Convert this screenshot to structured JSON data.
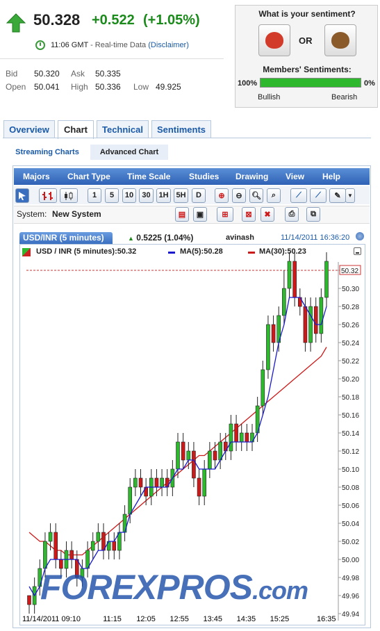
{
  "quote": {
    "price": "50.328",
    "change": "+0.522",
    "change_pct": "(+1.05%)",
    "time": "11:06 GMT",
    "time_note": "- Real-time Data",
    "disclaimer": "(Disclaimer)",
    "bid_label": "Bid",
    "bid": "50.320",
    "ask_label": "Ask",
    "ask": "50.335",
    "open_label": "Open",
    "open": "50.041",
    "high_label": "High",
    "high": "50.336",
    "low_label": "Low",
    "low": "49.925",
    "arrow_icon": "up-arrow-icon",
    "accent_color": "#1a8a1a"
  },
  "sentiment": {
    "title": "What is your sentiment?",
    "or": "OR",
    "members_label": "Members' Sentiments:",
    "bullish_pct": "100%",
    "bearish_pct": "0%",
    "bullish_label": "Bullish",
    "bearish_label": "Bearish",
    "bullish_fraction": 1.0
  },
  "tabs": [
    "Overview",
    "Chart",
    "Technical",
    "Sentiments"
  ],
  "active_tab": "Chart",
  "subtabs": [
    "Streaming Charts",
    "Advanced Chart"
  ],
  "active_subtab": "Advanced Chart",
  "menu": [
    "Majors",
    "Chart Type",
    "Time Scale",
    "Studies",
    "Drawing",
    "View",
    "Help"
  ],
  "toolbar": {
    "timeframes": [
      "1",
      "5",
      "10",
      "30",
      "1H",
      "5H",
      "D"
    ]
  },
  "system": {
    "label": "System:",
    "name": "New System"
  },
  "chart_header": {
    "instrument": "USD/INR (5 minutes)",
    "change": "0.5225 (1.04%)",
    "user": "avinash",
    "timestamp": "11/14/2011 16:36:20"
  },
  "legend": {
    "main": "USD / INR (5 minutes):50.32",
    "ma5": "MA(5):50.28",
    "ma30": "MA(30):50.23",
    "ma5_color": "#1a1acc",
    "ma30_color": "#cc1a1a"
  },
  "watermark": {
    "main": "FOREXPROS",
    "suffix": ".com"
  },
  "chart_data": {
    "type": "candlestick",
    "ylim": [
      49.93,
      50.34
    ],
    "yticks": [
      "50.32",
      "50.30",
      "50.28",
      "50.26",
      "50.24",
      "50.22",
      "50.20",
      "50.18",
      "50.16",
      "50.14",
      "50.12",
      "50.10",
      "50.08",
      "50.06",
      "50.04",
      "50.02",
      "50.00",
      "49.98",
      "49.96",
      "49.94"
    ],
    "last_price_label": "50.32",
    "x_labels": [
      "11/14/2011 09:10",
      "11:15",
      "12:05",
      "12:55",
      "13:45",
      "14:35",
      "15:25",
      "16:35"
    ],
    "x_label_index": [
      0,
      25,
      35,
      45,
      55,
      65,
      75,
      89
    ],
    "candles": [
      [
        49.96,
        49.95,
        49.96,
        49.94
      ],
      [
        49.95,
        49.97,
        49.98,
        49.94
      ],
      [
        49.97,
        49.99,
        50.0,
        49.96
      ],
      [
        49.99,
        50.02,
        50.03,
        49.98
      ],
      [
        50.02,
        50.03,
        50.04,
        50.01
      ],
      [
        50.03,
        50.0,
        50.04,
        49.99
      ],
      [
        50.0,
        49.99,
        50.01,
        49.98
      ],
      [
        49.99,
        50.01,
        50.02,
        49.98
      ],
      [
        50.01,
        50.0,
        50.02,
        49.99
      ],
      [
        50.0,
        49.98,
        50.01,
        49.97
      ],
      [
        49.98,
        49.99,
        50.0,
        49.97
      ],
      [
        49.99,
        50.01,
        50.02,
        49.98
      ],
      [
        50.01,
        50.02,
        50.03,
        50.0
      ],
      [
        50.02,
        50.03,
        50.04,
        50.01
      ],
      [
        50.03,
        50.01,
        50.04,
        50.0
      ],
      [
        50.01,
        50.02,
        50.03,
        50.0
      ],
      [
        50.02,
        50.01,
        50.03,
        50.0
      ],
      [
        50.01,
        50.03,
        50.04,
        50.0
      ],
      [
        50.03,
        50.05,
        50.06,
        50.02
      ],
      [
        50.05,
        50.08,
        50.09,
        50.04
      ],
      [
        50.08,
        50.09,
        50.1,
        50.07
      ],
      [
        50.09,
        50.08,
        50.1,
        50.07
      ],
      [
        50.08,
        50.07,
        50.09,
        50.06
      ],
      [
        50.07,
        50.09,
        50.1,
        50.06
      ],
      [
        50.09,
        50.08,
        50.1,
        50.07
      ],
      [
        50.08,
        50.09,
        50.1,
        50.07
      ],
      [
        50.09,
        50.08,
        50.1,
        50.07
      ],
      [
        50.08,
        50.1,
        50.11,
        50.07
      ],
      [
        50.1,
        50.13,
        50.14,
        50.09
      ],
      [
        50.13,
        50.11,
        50.14,
        50.1
      ],
      [
        50.11,
        50.12,
        50.13,
        50.1
      ],
      [
        50.12,
        50.09,
        50.13,
        50.08
      ],
      [
        50.09,
        50.07,
        50.1,
        50.06
      ],
      [
        50.07,
        50.1,
        50.11,
        50.06
      ],
      [
        50.1,
        50.12,
        50.13,
        50.09
      ],
      [
        50.12,
        50.11,
        50.13,
        50.1
      ],
      [
        50.11,
        50.13,
        50.14,
        50.1
      ],
      [
        50.13,
        50.12,
        50.14,
        50.11
      ],
      [
        50.12,
        50.15,
        50.16,
        50.11
      ],
      [
        50.15,
        50.13,
        50.16,
        50.12
      ],
      [
        50.13,
        50.14,
        50.15,
        50.12
      ],
      [
        50.14,
        50.13,
        50.15,
        50.12
      ],
      [
        50.13,
        50.14,
        50.15,
        50.12
      ],
      [
        50.14,
        50.17,
        50.18,
        50.13
      ],
      [
        50.17,
        50.21,
        50.22,
        50.16
      ],
      [
        50.21,
        50.26,
        50.27,
        50.2
      ],
      [
        50.26,
        50.24,
        50.27,
        50.23
      ],
      [
        50.24,
        50.27,
        50.28,
        50.23
      ],
      [
        50.27,
        50.3,
        50.32,
        50.26
      ],
      [
        50.3,
        50.33,
        50.34,
        50.29
      ],
      [
        50.33,
        50.29,
        50.34,
        50.28
      ],
      [
        50.29,
        50.28,
        50.3,
        50.27
      ],
      [
        50.28,
        50.24,
        50.29,
        50.23
      ],
      [
        50.24,
        50.28,
        50.29,
        50.23
      ],
      [
        50.28,
        50.25,
        50.29,
        50.24
      ],
      [
        50.25,
        50.29,
        50.3,
        50.24
      ],
      [
        50.29,
        50.33,
        50.34,
        50.28
      ]
    ],
    "ma5": [
      49.97,
      49.96,
      49.97,
      49.99,
      50.0,
      50.0,
      50.0,
      50.0,
      50.0,
      50.0,
      49.99,
      49.99,
      50.0,
      50.01,
      50.01,
      50.02,
      50.02,
      50.03,
      50.03,
      50.05,
      50.06,
      50.07,
      50.08,
      50.08,
      50.08,
      50.08,
      50.08,
      50.09,
      50.1,
      50.1,
      50.11,
      50.11,
      50.1,
      50.1,
      50.1,
      50.1,
      50.11,
      50.12,
      50.13,
      50.13,
      50.13,
      50.13,
      50.13,
      50.14,
      50.16,
      50.18,
      50.21,
      50.24,
      50.26,
      50.29,
      50.29,
      50.29,
      50.28,
      50.27,
      50.26,
      50.26,
      50.28
    ],
    "ma30": [
      50.03,
      50.025,
      50.02,
      50.02,
      50.015,
      50.01,
      50.01,
      50.005,
      50.005,
      50.005,
      50.005,
      50.01,
      50.015,
      50.02,
      50.025,
      50.03,
      50.035,
      50.04,
      50.045,
      50.05,
      50.055,
      50.06,
      50.065,
      50.07,
      50.075,
      50.08,
      50.085,
      50.09,
      50.095,
      50.1,
      50.105,
      50.11,
      50.115,
      50.115,
      50.12,
      50.125,
      50.13,
      50.135,
      50.14,
      50.145,
      50.15,
      50.155,
      50.16,
      50.165,
      50.17,
      50.175,
      50.18,
      50.185,
      50.19,
      50.195,
      50.2,
      50.205,
      50.21,
      50.215,
      50.22,
      50.225,
      50.235
    ]
  }
}
